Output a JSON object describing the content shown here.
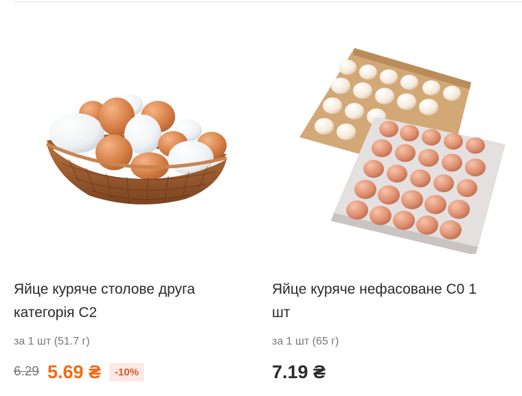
{
  "products": [
    {
      "image_icon": "eggs-in-basket-icon",
      "title": "Яйце куряче столове друга категорія С2",
      "weight": "за 1 шт (51.7 г)",
      "old_price": "6.29",
      "price": "5.69 ₴",
      "discount": "-10%"
    },
    {
      "image_icon": "eggs-in-trays-icon",
      "title": "Яйце куряче нефасоване С0 1 шт",
      "weight": "за 1 шт (65 г)",
      "price": "7.19 ₴"
    }
  ],
  "colors": {
    "accent_price": "#f36a10",
    "discount_bg": "#fde9e3",
    "discount_text": "#e2532a"
  }
}
